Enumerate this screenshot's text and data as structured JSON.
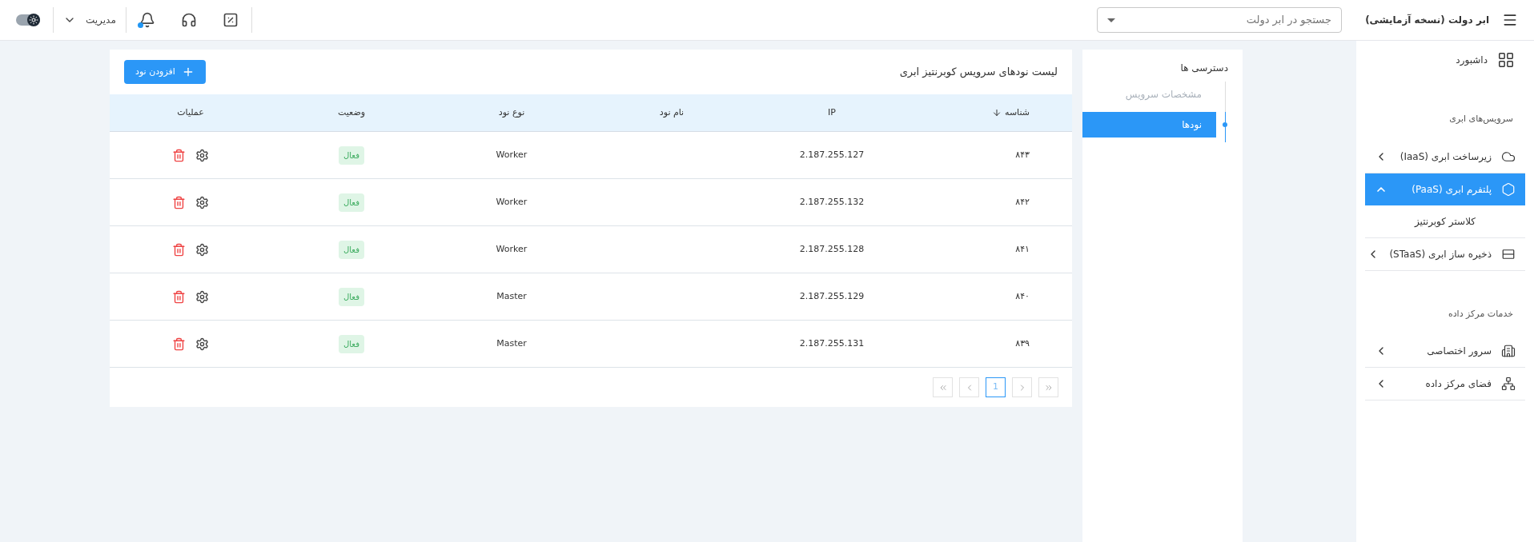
{
  "header": {
    "title": "ابر دولت (نسخه آزمایشی)",
    "search": {
      "placeholder": "جستجو در ابر دولت"
    },
    "user_menu": {
      "label": "مدیریت"
    },
    "notifications": {
      "unread": true
    },
    "theme_toggle": {
      "on": true
    }
  },
  "sidebar": {
    "dashboard": {
      "label": "داشبورد"
    },
    "sections": [
      {
        "title": "سرویس‌های ابری",
        "items": [
          {
            "label": "زیرساخت ابری (IaaS)",
            "expanded": false,
            "selected": false
          },
          {
            "label": "پلتفرم ابری (PaaS)",
            "expanded": true,
            "selected": true,
            "children": [
              {
                "label": "کلاستر کوبرنتیز"
              }
            ]
          },
          {
            "label": "ذخیره ساز ابری (STaaS)",
            "expanded": false,
            "selected": false
          }
        ]
      },
      {
        "title": "خدمات مرکز داده",
        "items": [
          {
            "label": "سرور اختصاصی",
            "expanded": false,
            "selected": false
          },
          {
            "label": "فضای مرکز داده",
            "expanded": false,
            "selected": false
          }
        ]
      }
    ]
  },
  "access_nav": {
    "title": "دسترسی ها",
    "items": [
      {
        "label": "مشخصات سرویس",
        "selected": false
      },
      {
        "label": "نودها",
        "selected": true
      }
    ]
  },
  "table": {
    "title": "لیست نودهای سرویس کوبرنتیز ابری",
    "add_button": "افزودن نود",
    "columns": [
      {
        "label": "شناسه",
        "sorted": true
      },
      {
        "label": "IP",
        "sorted": false
      },
      {
        "label": "نام نود",
        "sorted": false
      },
      {
        "label": "نوع نود",
        "sorted": false
      },
      {
        "label": "وضعیت",
        "sorted": false
      },
      {
        "label": "عملیات",
        "sorted": false
      }
    ],
    "rows": [
      {
        "id": "۸۴۳",
        "ip": "2.187.255.127",
        "type": "Worker",
        "status": "فعال"
      },
      {
        "id": "۸۴۲",
        "ip": "2.187.255.132",
        "type": "Worker",
        "status": "فعال"
      },
      {
        "id": "۸۴۱",
        "ip": "2.187.255.128",
        "type": "Worker",
        "status": "فعال"
      },
      {
        "id": "۸۴۰",
        "ip": "2.187.255.129",
        "type": "Master",
        "status": "فعال"
      },
      {
        "id": "۸۳۹",
        "ip": "2.187.255.131",
        "type": "Master",
        "status": "فعال"
      }
    ],
    "pagination": {
      "pages": [
        {
          "label": "1",
          "selected": true
        }
      ]
    }
  }
}
